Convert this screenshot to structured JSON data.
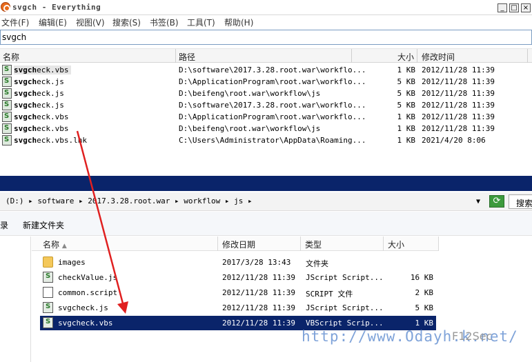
{
  "everything": {
    "title": "svgch - Everything",
    "window_controls": [
      "_",
      "□",
      "×"
    ],
    "menu": [
      "文件(F)",
      "编辑(E)",
      "视图(V)",
      "搜索(S)",
      "书签(B)",
      "工具(T)",
      "帮助(H)"
    ],
    "search_value": "svgch",
    "columns": [
      "名称",
      "路径",
      "大小",
      "修改时间"
    ],
    "results": [
      {
        "name_bold": "svgch",
        "name_rest": "eck.vbs",
        "path": "D:\\software\\2017.3.28.root.war\\workflo...",
        "size": "1 KB",
        "modified": "2012/11/28 11:39"
      },
      {
        "name_bold": "svgch",
        "name_rest": "eck.js",
        "path": "D:\\ApplicationProgram\\root.war\\workflo...",
        "size": "5 KB",
        "modified": "2012/11/28 11:39"
      },
      {
        "name_bold": "svgch",
        "name_rest": "eck.js",
        "path": "D:\\beifeng\\root.war\\workflow\\js",
        "size": "5 KB",
        "modified": "2012/11/28 11:39"
      },
      {
        "name_bold": "svgch",
        "name_rest": "eck.js",
        "path": "D:\\software\\2017.3.28.root.war\\workflo...",
        "size": "5 KB",
        "modified": "2012/11/28 11:39"
      },
      {
        "name_bold": "svgch",
        "name_rest": "eck.vbs",
        "path": "D:\\ApplicationProgram\\root.war\\workflo...",
        "size": "1 KB",
        "modified": "2012/11/28 11:39"
      },
      {
        "name_bold": "svgch",
        "name_rest": "eck.vbs",
        "path": "D:\\beifeng\\root.war\\workflow\\js",
        "size": "1 KB",
        "modified": "2012/11/28 11:39"
      },
      {
        "name_bold": "svgch",
        "name_rest": "eck.vbs.lnk",
        "path": "C:\\Users\\Administrator\\AppData\\Roaming...",
        "size": "1 KB",
        "modified": "2021/4/20 8:06"
      }
    ]
  },
  "explorer": {
    "address": "(D:) ▸ software ▸ 2017.3.28.root.war ▸ workflow ▸ js ▸",
    "search_label": "搜索",
    "toolbar": [
      "录",
      "新建文件夹"
    ],
    "columns": [
      "名称",
      "修改日期",
      "类型",
      "大小"
    ],
    "files": [
      {
        "name": "images",
        "modified": "2017/3/28 13:43",
        "type": "文件夹",
        "size": "",
        "icon": "folder-icon"
      },
      {
        "name": "checkValue.js",
        "modified": "2012/11/28 11:39",
        "type": "JScript Script...",
        "size": "16 KB",
        "icon": "script-file-icon"
      },
      {
        "name": "common.script",
        "modified": "2012/11/28 11:39",
        "type": "SCRIPT 文件",
        "size": "2 KB",
        "icon": "document-icon"
      },
      {
        "name": "svgcheck.js",
        "modified": "2012/11/28 11:39",
        "type": "JScript Script...",
        "size": "5 KB",
        "icon": "script-file-icon"
      },
      {
        "name": "svgcheck.vbs",
        "modified": "2012/11/28 11:39",
        "type": "VBScript Scrip...",
        "size": "1 KB",
        "icon": "script-file-icon"
      }
    ]
  },
  "watermark": {
    "url": "http://www.Odayh.k.net/",
    "logo": "F12Sec"
  },
  "colors": {
    "selection": "#0a246a",
    "arrow": "#e02020",
    "watermark": "#7fa3d9"
  }
}
